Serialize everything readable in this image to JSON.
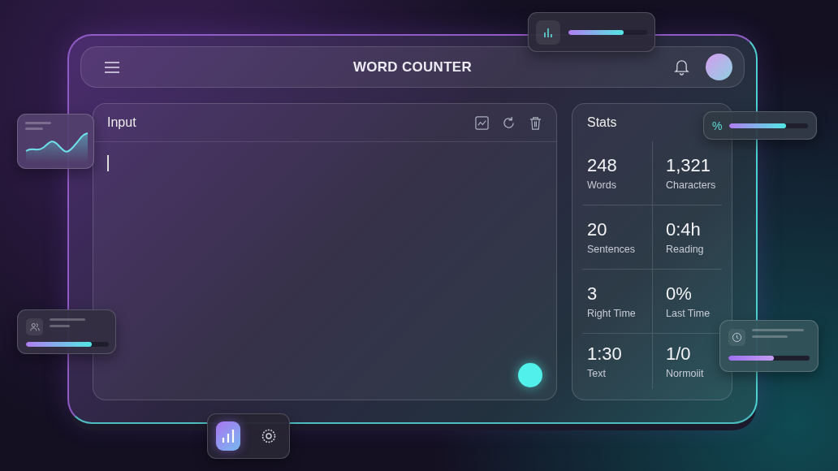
{
  "header": {
    "title": "WORD COUNTER"
  },
  "input_panel": {
    "title": "Input"
  },
  "stats": {
    "title": "Stats",
    "items": [
      {
        "value": "248",
        "label": "Words"
      },
      {
        "value": "1,321",
        "label": "Characters"
      },
      {
        "value": "20",
        "label": "Sentences"
      },
      {
        "value": "0:4h",
        "label": "Reading"
      },
      {
        "value": "3",
        "label": "Right Time"
      },
      {
        "value": "0%",
        "label": "Last Time"
      },
      {
        "value": "1:30",
        "label": "Text"
      },
      {
        "value": "1/0",
        "label": "Normoiit"
      }
    ]
  },
  "top_meter": {
    "level": 0.7
  },
  "percent_meter": {
    "symbol": "%",
    "level": 0.72
  },
  "users_card": {
    "level": 0.79
  },
  "clock_card": {
    "level": 0.56
  },
  "dock": [
    {
      "selected": true
    },
    {
      "selected": false
    }
  ]
}
